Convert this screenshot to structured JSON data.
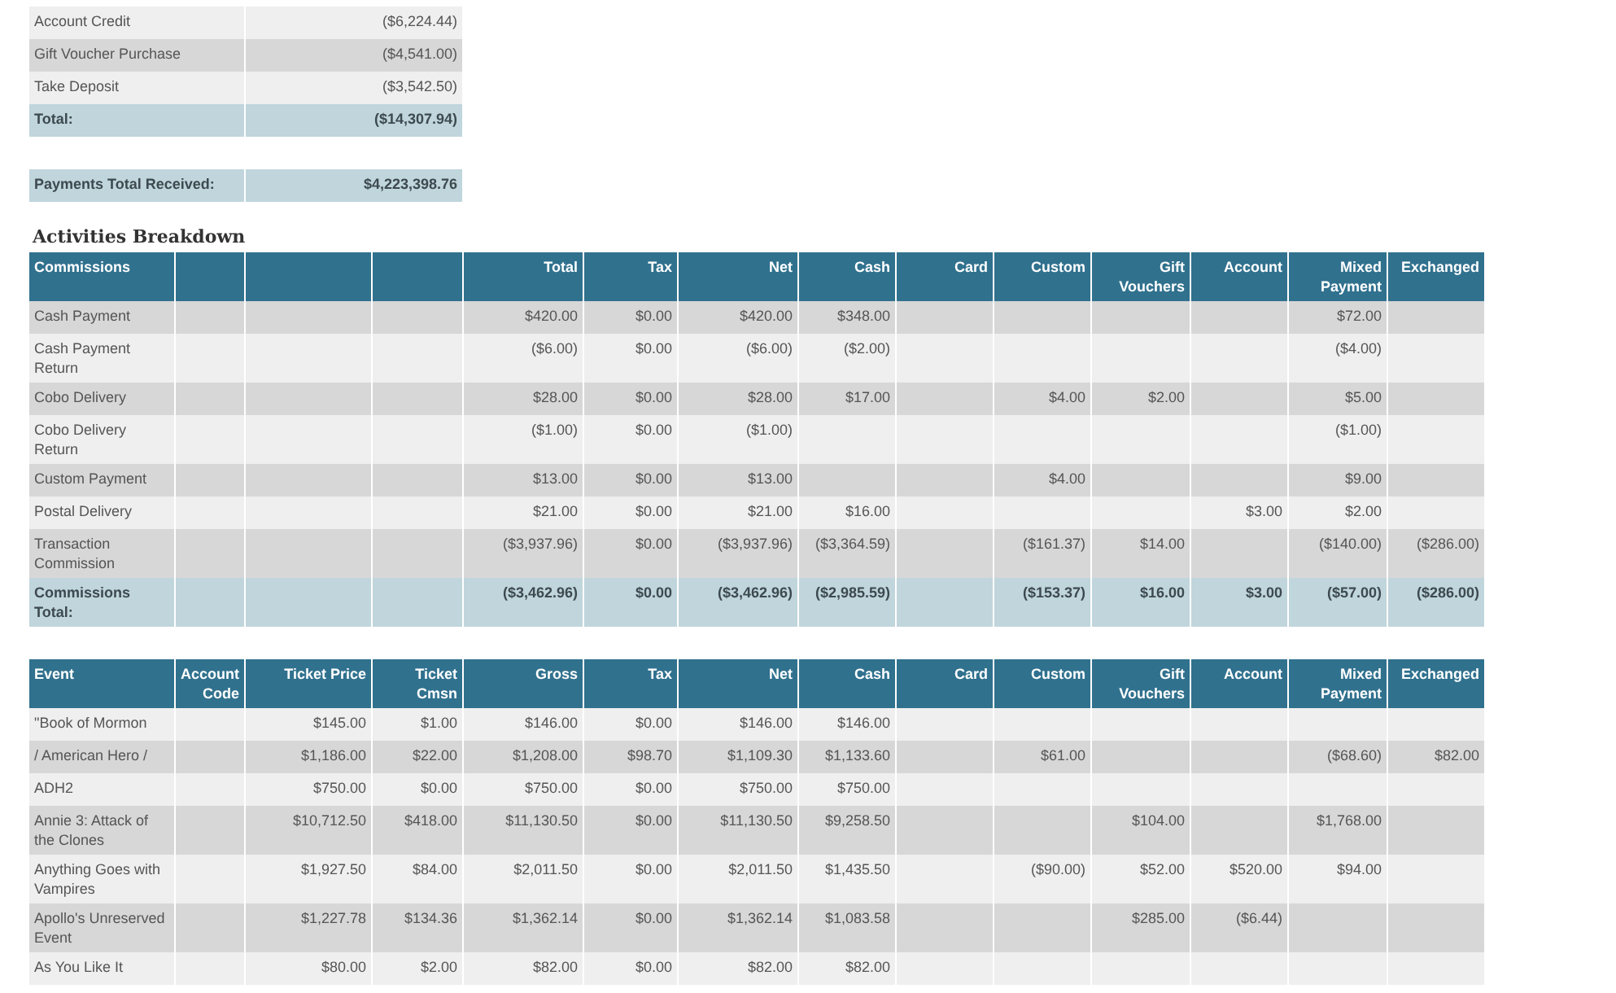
{
  "summary_table": {
    "rows": [
      {
        "label": "Account Credit",
        "value": "($6,224.44)",
        "kind": "item"
      },
      {
        "label": "Gift Voucher Purchase",
        "value": "($4,541.00)",
        "kind": "item"
      },
      {
        "label": "Take Deposit",
        "value": "($3,542.50)",
        "kind": "item"
      },
      {
        "label": "Total:",
        "value": "($14,307.94)",
        "kind": "total"
      }
    ]
  },
  "payments_total": {
    "label": "Payments Total Received:",
    "value": "$4,223,398.76"
  },
  "activities": {
    "title": "Activities Breakdown",
    "columns": [
      "Commissions",
      null,
      null,
      null,
      "Total",
      "Tax",
      "Net",
      "Cash",
      "Card",
      "Custom",
      "Gift Vouchers",
      "Account",
      "Mixed Payment",
      "Exchanged"
    ],
    "rows": [
      {
        "kind": "item",
        "cells": [
          "Cash Payment",
          null,
          null,
          null,
          "$420.00",
          "$0.00",
          "$420.00",
          "$348.00",
          null,
          null,
          null,
          null,
          "$72.00",
          null
        ]
      },
      {
        "kind": "item",
        "cells": [
          "Cash Payment Return",
          null,
          null,
          null,
          "($6.00)",
          "$0.00",
          "($6.00)",
          "($2.00)",
          null,
          null,
          null,
          null,
          "($4.00)",
          null
        ]
      },
      {
        "kind": "item",
        "cells": [
          "Cobo Delivery",
          null,
          null,
          null,
          "$28.00",
          "$0.00",
          "$28.00",
          "$17.00",
          null,
          "$4.00",
          "$2.00",
          null,
          "$5.00",
          null
        ]
      },
      {
        "kind": "item",
        "cells": [
          "Cobo Delivery Return",
          null,
          null,
          null,
          "($1.00)",
          "$0.00",
          "($1.00)",
          null,
          null,
          null,
          null,
          null,
          "($1.00)",
          null
        ]
      },
      {
        "kind": "item",
        "cells": [
          "Custom Payment",
          null,
          null,
          null,
          "$13.00",
          "$0.00",
          "$13.00",
          null,
          null,
          "$4.00",
          null,
          null,
          "$9.00",
          null
        ]
      },
      {
        "kind": "item",
        "cells": [
          "Postal Delivery",
          null,
          null,
          null,
          "$21.00",
          "$0.00",
          "$21.00",
          "$16.00",
          null,
          null,
          null,
          "$3.00",
          "$2.00",
          null
        ]
      },
      {
        "kind": "item",
        "cells": [
          "Transaction Commission",
          null,
          null,
          null,
          "($3,937.96)",
          "$0.00",
          "($3,937.96)",
          "($3,364.59)",
          null,
          "($161.37)",
          "$14.00",
          null,
          "($140.00)",
          "($286.00)"
        ]
      },
      {
        "kind": "total",
        "cells": [
          "Commissions Total:",
          null,
          null,
          null,
          "($3,462.96)",
          "$0.00",
          "($3,462.96)",
          "($2,985.59)",
          null,
          "($153.37)",
          "$16.00",
          "$3.00",
          "($57.00)",
          "($286.00)"
        ]
      }
    ]
  },
  "events": {
    "columns": [
      "Event",
      "Account Code",
      "Ticket Price",
      "Ticket Cmsn",
      "Gross",
      "Tax",
      "Net",
      "Cash",
      "Card",
      "Custom",
      "Gift Vouchers",
      "Account",
      "Mixed Payment",
      "Exchanged"
    ],
    "rows": [
      {
        "cells": [
          "\"Book of Mormon",
          null,
          "$145.00",
          "$1.00",
          "$146.00",
          "$0.00",
          "$146.00",
          "$146.00",
          null,
          null,
          null,
          null,
          null,
          null
        ]
      },
      {
        "cells": [
          "/ American Hero /",
          null,
          "$1,186.00",
          "$22.00",
          "$1,208.00",
          "$98.70",
          "$1,109.30",
          "$1,133.60",
          null,
          "$61.00",
          null,
          null,
          "($68.60)",
          "$82.00"
        ]
      },
      {
        "cells": [
          "ADH2",
          null,
          "$750.00",
          "$0.00",
          "$750.00",
          "$0.00",
          "$750.00",
          "$750.00",
          null,
          null,
          null,
          null,
          null,
          null
        ]
      },
      {
        "cells": [
          "Annie 3: Attack of the Clones",
          null,
          "$10,712.50",
          "$418.00",
          "$11,130.50",
          "$0.00",
          "$11,130.50",
          "$9,258.50",
          null,
          null,
          "$104.00",
          null,
          "$1,768.00",
          null
        ]
      },
      {
        "cells": [
          "Anything Goes with Vampires",
          null,
          "$1,927.50",
          "$84.00",
          "$2,011.50",
          "$0.00",
          "$2,011.50",
          "$1,435.50",
          null,
          "($90.00)",
          "$52.00",
          "$520.00",
          "$94.00",
          null
        ]
      },
      {
        "cells": [
          "Apollo's Unreserved Event",
          null,
          "$1,227.78",
          "$134.36",
          "$1,362.14",
          "$0.00",
          "$1,362.14",
          "$1,083.58",
          null,
          null,
          "$285.00",
          "($6.44)",
          null,
          null
        ]
      },
      {
        "cells": [
          "As You Like It",
          null,
          "$80.00",
          "$2.00",
          "$82.00",
          "$0.00",
          "$82.00",
          "$82.00",
          null,
          null,
          null,
          null,
          null,
          null
        ]
      }
    ]
  }
}
